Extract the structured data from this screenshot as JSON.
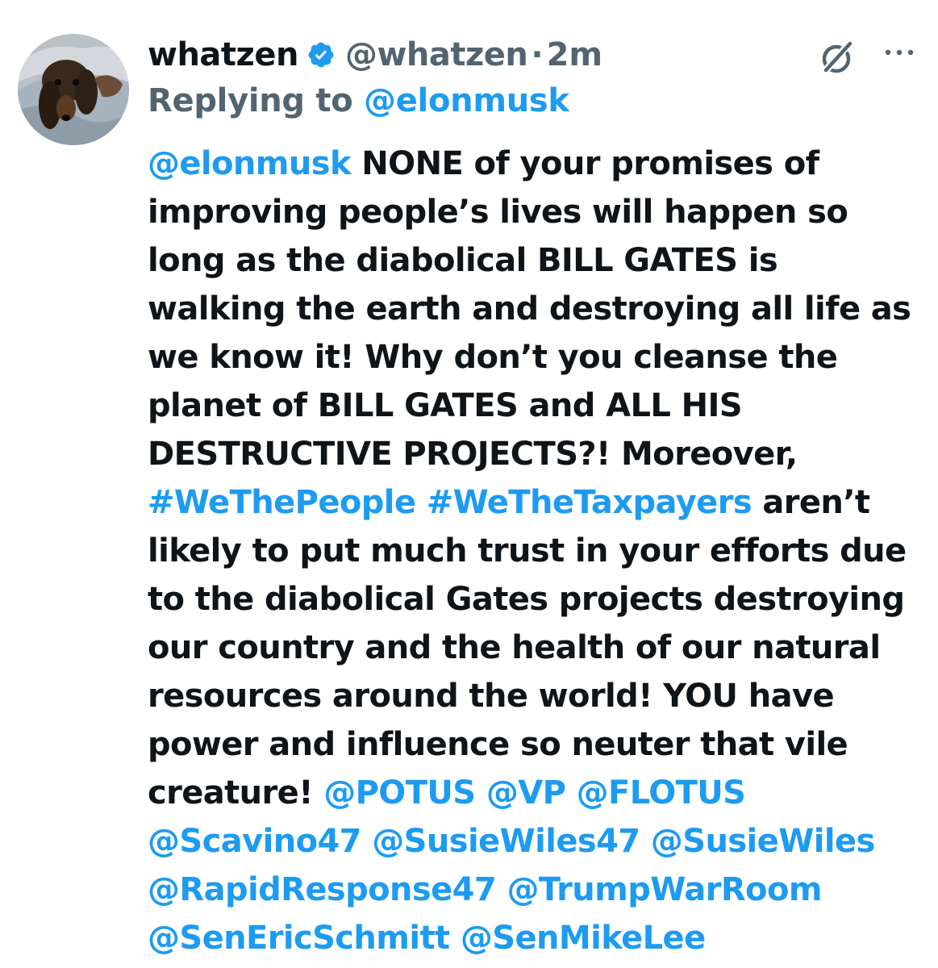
{
  "tweet": {
    "display_name": "whatzen",
    "handle": "@whatzen",
    "separator": "·",
    "time": "2m",
    "verified_icon": "verified-badge-icon",
    "grok_icon": "grok-icon",
    "more_icon": "more-horizontal-icon",
    "replying_prefix": "Replying to ",
    "replying_to": "@elonmusk",
    "body_lines": [
      [
        {
          "t": "mention",
          "v": "@elonmusk"
        },
        {
          "t": "text",
          "v": " NONE of your promises of"
        }
      ],
      [
        {
          "t": "text",
          "v": "improving people’s lives will happen so"
        }
      ],
      [
        {
          "t": "text",
          "v": "long as the diabolical BILL GATES is"
        }
      ],
      [
        {
          "t": "text",
          "v": "walking the earth and destroying all life as"
        }
      ],
      [
        {
          "t": "text",
          "v": "we know it!  Why don’t you cleanse the"
        }
      ],
      [
        {
          "t": "text",
          "v": "planet of BILL GATES and ALL HIS"
        }
      ],
      [
        {
          "t": "text",
          "v": "DESTRUCTIVE PROJECTS?! Moreover,"
        }
      ],
      [
        {
          "t": "hashtag",
          "v": "#WeThePeople"
        },
        {
          "t": "text",
          "v": " "
        },
        {
          "t": "hashtag",
          "v": "#WeTheTaxpayers"
        },
        {
          "t": "text",
          "v": " aren’t"
        }
      ],
      [
        {
          "t": "text",
          "v": "likely to put much trust in your efforts due"
        }
      ],
      [
        {
          "t": "text",
          "v": "to the diabolical Gates projects destroying"
        }
      ],
      [
        {
          "t": "text",
          "v": "our country and the health of our natural"
        }
      ],
      [
        {
          "t": "text",
          "v": "resources around the world! YOU have"
        }
      ],
      [
        {
          "t": "text",
          "v": "power and influence so neuter that vile"
        }
      ],
      [
        {
          "t": "text",
          "v": "creature! "
        },
        {
          "t": "mention",
          "v": "@POTUS"
        },
        {
          "t": "text",
          "v": " "
        },
        {
          "t": "mention",
          "v": "@VP"
        },
        {
          "t": "text",
          "v": " "
        },
        {
          "t": "mention",
          "v": "@FLOTUS"
        }
      ],
      [
        {
          "t": "mention",
          "v": "@Scavino47"
        },
        {
          "t": "text",
          "v": " "
        },
        {
          "t": "mention",
          "v": "@SusieWiles47"
        },
        {
          "t": "text",
          "v": " "
        },
        {
          "t": "mention",
          "v": "@SusieWiles"
        }
      ],
      [
        {
          "t": "mention",
          "v": "@RapidResponse47"
        },
        {
          "t": "text",
          "v": " "
        },
        {
          "t": "mention",
          "v": "@TrumpWarRoom"
        }
      ],
      [
        {
          "t": "mention",
          "v": "@SenEricSchmitt"
        },
        {
          "t": "text",
          "v": " "
        },
        {
          "t": "mention",
          "v": "@SenMikeLee"
        }
      ]
    ]
  },
  "colors": {
    "text": "#0f1419",
    "secondary": "#536471",
    "link": "#1d9bf0",
    "verified": "#1d9bf0"
  }
}
